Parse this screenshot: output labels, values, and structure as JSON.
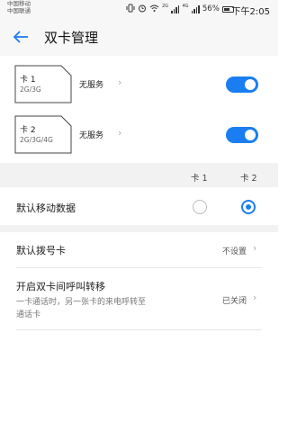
{
  "status_bar": {
    "carrier_1": "中国移动",
    "carrier_2": "中国联通",
    "sig1_tag": "2G",
    "sig2_tag": "4G",
    "battery": "56%",
    "time": "下午2:05"
  },
  "header": {
    "title": "双卡管理"
  },
  "sims": [
    {
      "name": "卡 1",
      "network": "2G/3G",
      "status": "无服务",
      "enabled": true
    },
    {
      "name": "卡 2",
      "network": "2G/3G/4G",
      "status": "无服务",
      "enabled": true
    }
  ],
  "columns": {
    "sim1": "卡 1",
    "sim2": "卡 2"
  },
  "default_data": {
    "label": "默认移动数据",
    "selected": "卡 2"
  },
  "default_dial": {
    "label": "默认拨号卡",
    "value": "不设置"
  },
  "call_forward": {
    "label": "开启双卡间呼叫转移",
    "desc_line1": "一卡通话时，另一张卡的来电呼转至",
    "desc_line2": "通话卡",
    "value": "已关闭"
  },
  "colors": {
    "accent": "#1a7ef2"
  }
}
